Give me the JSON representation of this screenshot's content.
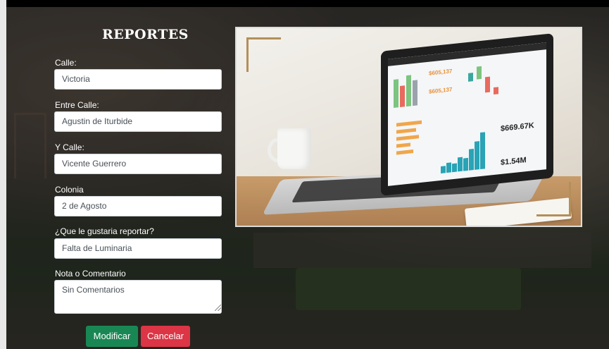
{
  "form": {
    "title": "REPORTES",
    "fields": [
      {
        "label": "Calle:",
        "value": "Victoria"
      },
      {
        "label": "Entre Calle:",
        "value": "Agustin de Iturbide"
      },
      {
        "label": "Y Calle:",
        "value": "Vicente Guerrero"
      },
      {
        "label": "Colonia",
        "value": "2 de Agosto"
      },
      {
        "label": "¿Que le gustaria reportar?",
        "value": "Falta de Luminaria"
      }
    ],
    "note": {
      "label": "Nota o Comentario",
      "value": "Sin Comentarios"
    },
    "buttons": {
      "modify": "Modificar",
      "cancel": "Cancelar"
    }
  },
  "photo": {
    "screen_values": [
      "$669.67K",
      "$1.54M",
      "$605,137",
      "$605,137"
    ]
  },
  "colors": {
    "modify_button": "#198754",
    "cancel_button": "#dc3545",
    "frame_accent": "#b38f5a"
  }
}
